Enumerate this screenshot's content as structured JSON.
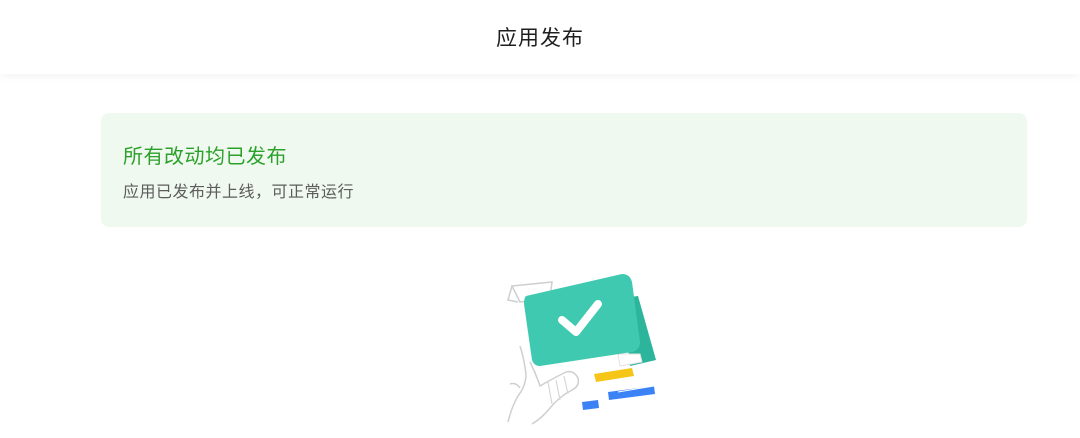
{
  "header": {
    "title": "应用发布"
  },
  "notice": {
    "title": "所有改动均已发布",
    "description": "应用已发布并上线，可正常运行"
  },
  "illustration": {
    "icon": "published-check-illustration",
    "colors": {
      "card": "#3ec9b0",
      "card_back": "#2db59c",
      "check": "#ffffff",
      "bar_yellow": "#f5c518",
      "bar_blue": "#3b82f6",
      "line": "#cfcfcf"
    }
  }
}
